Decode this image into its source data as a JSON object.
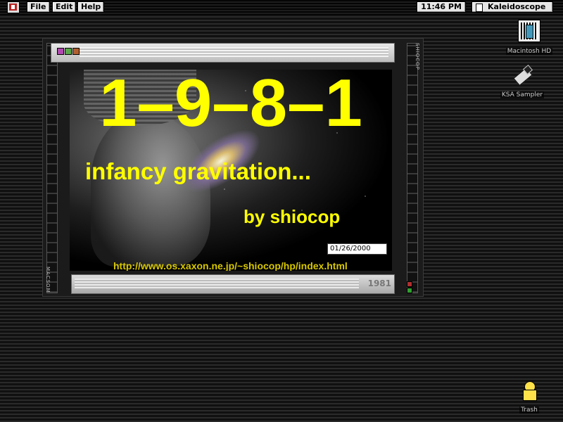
{
  "menubar": {
    "items": [
      "File",
      "Edit",
      "Help"
    ],
    "clock": "11:46 PM",
    "active_app": "Kaleidoscope"
  },
  "desktop": {
    "icons": [
      {
        "label": "Macintosh HD",
        "icon": "hard-disk-icon"
      },
      {
        "label": "KSA Sampler",
        "icon": "pencil-tool-icon"
      },
      {
        "label": "Trash",
        "icon": "trash-icon"
      }
    ]
  },
  "window": {
    "side_label_right": "SHIOCOP",
    "side_label_left": "MACSOM",
    "bottom_mark": "1981",
    "content": {
      "year": "1–9–8–1",
      "subtitle": "infancy gravitation...",
      "byline": "by shiocop",
      "date": "01/26/2000",
      "url": "http://www.os.xaxon.ne.jp/~shiocop/hp/index.html"
    }
  },
  "colors": {
    "accent_text": "#ffff00",
    "url_text": "#d8c800",
    "swatches": [
      "#b04ab0",
      "#5aa84a",
      "#b06030"
    ]
  }
}
